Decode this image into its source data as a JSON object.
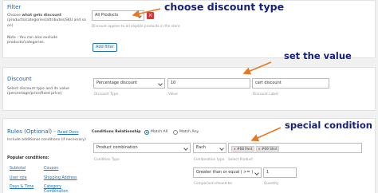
{
  "colors": {
    "title": "#2565b3",
    "link": "#2271b1",
    "annotation": "#16207e",
    "arrow": "#e87722",
    "remove": "#d63638"
  },
  "filter": {
    "title": "Filter",
    "desc_pre": "Choose ",
    "desc_bold": "what gets discount",
    "desc_post": " (products/categories/attributes/SKU and so on)",
    "note": "Note : You can also exclude products/categories.",
    "select_value": "All Products",
    "hint": "Discount applies to all eligible products in the store",
    "remove_icon": "×",
    "add_button": "Add filter"
  },
  "discount": {
    "title": "Discount",
    "desc": "Select discount type and its value (percentage/price/fixed price)",
    "type_value": "Percentage discount",
    "value_value": "10",
    "label_value": "cart discount",
    "type_hint": "Discount Type",
    "value_hint": "Value",
    "label_hint": "Discount Label"
  },
  "rules": {
    "title": "Rules (Optional) - ",
    "read_docs": "Read Docs",
    "desc": "Include additional conditions (if necessary)",
    "popular": "Popular conditions:",
    "links": [
      "Subtotal",
      "Coupon",
      "User role",
      "Shipping Address",
      "Days & Time",
      "Category Combination"
    ],
    "relationship_label": "Conditions Relationship",
    "match_all": "Match All",
    "match_any": "Match Any",
    "condition_select": "Product combination",
    "each_select": "Each",
    "tags": [
      "#68 Pant",
      "#69 Shirt"
    ],
    "tag_remove": "×",
    "condition_hint": "Condition Type",
    "combination_hint": "Combination type",
    "select_product_hint": "Select Product",
    "operator_select": "Greater than or equal ( >= )",
    "quantity_value": "1",
    "comparison_hint": "Comparison should be",
    "quantity_hint": "Quantity"
  },
  "annotations": {
    "choose": "choose discount type",
    "set_value": "set the value",
    "special": "special condition"
  }
}
